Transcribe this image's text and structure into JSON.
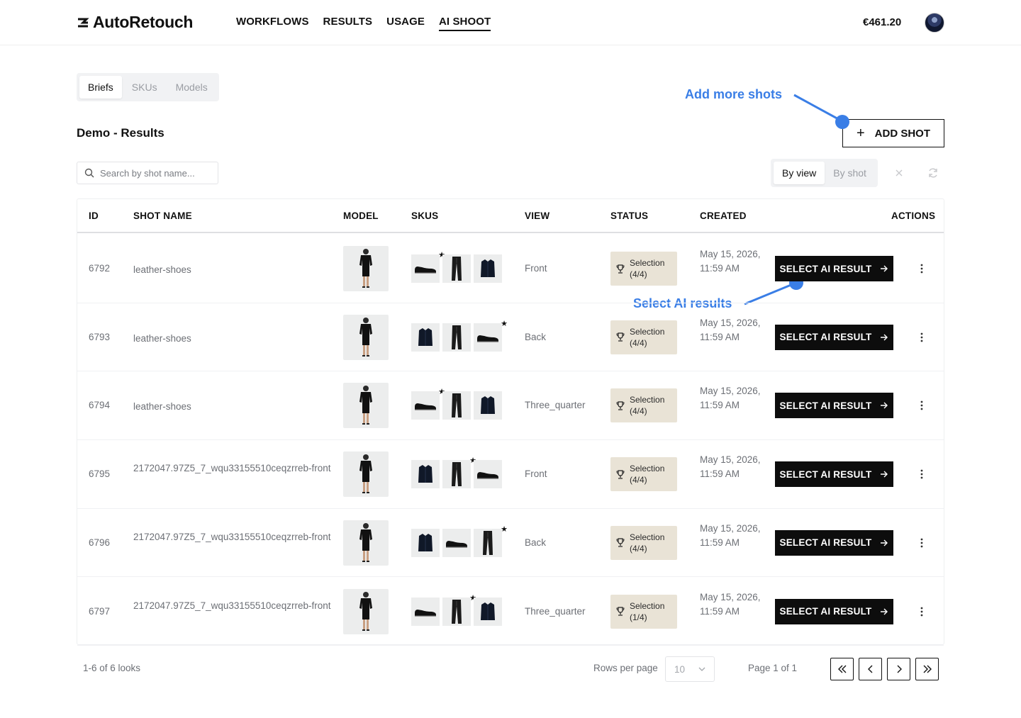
{
  "header": {
    "brand": "AutoRetouch",
    "nav": [
      "WORKFLOWS",
      "RESULTS",
      "USAGE",
      "AI SHOOT"
    ],
    "active_nav": "AI SHOOT",
    "balance": "€461.20"
  },
  "tabs": [
    "Briefs",
    "SKUs",
    "Models"
  ],
  "active_tab": "Briefs",
  "page_title": "Demo - Results",
  "add_shot_label": "ADD SHOT",
  "annotations": {
    "add_more": "Add more shots",
    "select_results": "Select AI results"
  },
  "search": {
    "placeholder": "Search by shot name..."
  },
  "view_toggle": [
    "By view",
    "By shot"
  ],
  "active_view": "By view",
  "table": {
    "headers": [
      "ID",
      "SHOT NAME",
      "MODEL",
      "SKUS",
      "VIEW",
      "STATUS",
      "CREATED",
      "ACTIONS"
    ],
    "rows": [
      {
        "id": "6792",
        "shot_name": "leather-shoes",
        "view": "Front",
        "status_line1": "Selection",
        "status_line2": "(4/4)",
        "created": "May 15, 2026, 11:59 AM",
        "skus": [
          "shoe",
          "pants",
          "jacket"
        ],
        "star_index": 0,
        "action": "SELECT AI RESULT"
      },
      {
        "id": "6793",
        "shot_name": "leather-shoes",
        "view": "Back",
        "status_line1": "Selection",
        "status_line2": "(4/4)",
        "created": "May 15, 2026, 11:59 AM",
        "skus": [
          "jacket",
          "pants",
          "shoe"
        ],
        "star_index": 2,
        "action": "SELECT AI RESULT"
      },
      {
        "id": "6794",
        "shot_name": "leather-shoes",
        "view": "Three_quarter",
        "status_line1": "Selection",
        "status_line2": "(4/4)",
        "created": "May 15, 2026, 11:59 AM",
        "skus": [
          "shoe",
          "pants",
          "jacket"
        ],
        "star_index": 0,
        "action": "SELECT AI RESULT"
      },
      {
        "id": "6795",
        "shot_name": "2172047.97Z5_7_wqu33155510ceqzrreb-front",
        "view": "Front",
        "status_line1": "Selection",
        "status_line2": "(4/4)",
        "created": "May 15, 2026, 11:59 AM",
        "skus": [
          "jacket",
          "pants",
          "shoe"
        ],
        "star_index": 1,
        "action": "SELECT AI RESULT"
      },
      {
        "id": "6796",
        "shot_name": "2172047.97Z5_7_wqu33155510ceqzrreb-front",
        "view": "Back",
        "status_line1": "Selection",
        "status_line2": "(4/4)",
        "created": "May 15, 2026, 11:59 AM",
        "skus": [
          "jacket",
          "shoe",
          "pants"
        ],
        "star_index": 2,
        "action": "SELECT AI RESULT"
      },
      {
        "id": "6797",
        "shot_name": "2172047.97Z5_7_wqu33155510ceqzrreb-front",
        "view": "Three_quarter",
        "status_line1": "Selection",
        "status_line2": "(1/4)",
        "created": "May 15, 2026, 11:59 AM",
        "skus": [
          "shoe",
          "pants",
          "jacket"
        ],
        "star_index": 1,
        "action": "SELECT AI RESULT"
      }
    ]
  },
  "footer": {
    "count": "1-6 of 6 looks",
    "rows_per_page_label": "Rows per page",
    "rows_per_page_value": "10",
    "page_info": "Page 1 of 1"
  },
  "colors": {
    "accent": "#3a7ee6",
    "status_bg": "#e9e3d6",
    "button": "#0d0d0d"
  }
}
